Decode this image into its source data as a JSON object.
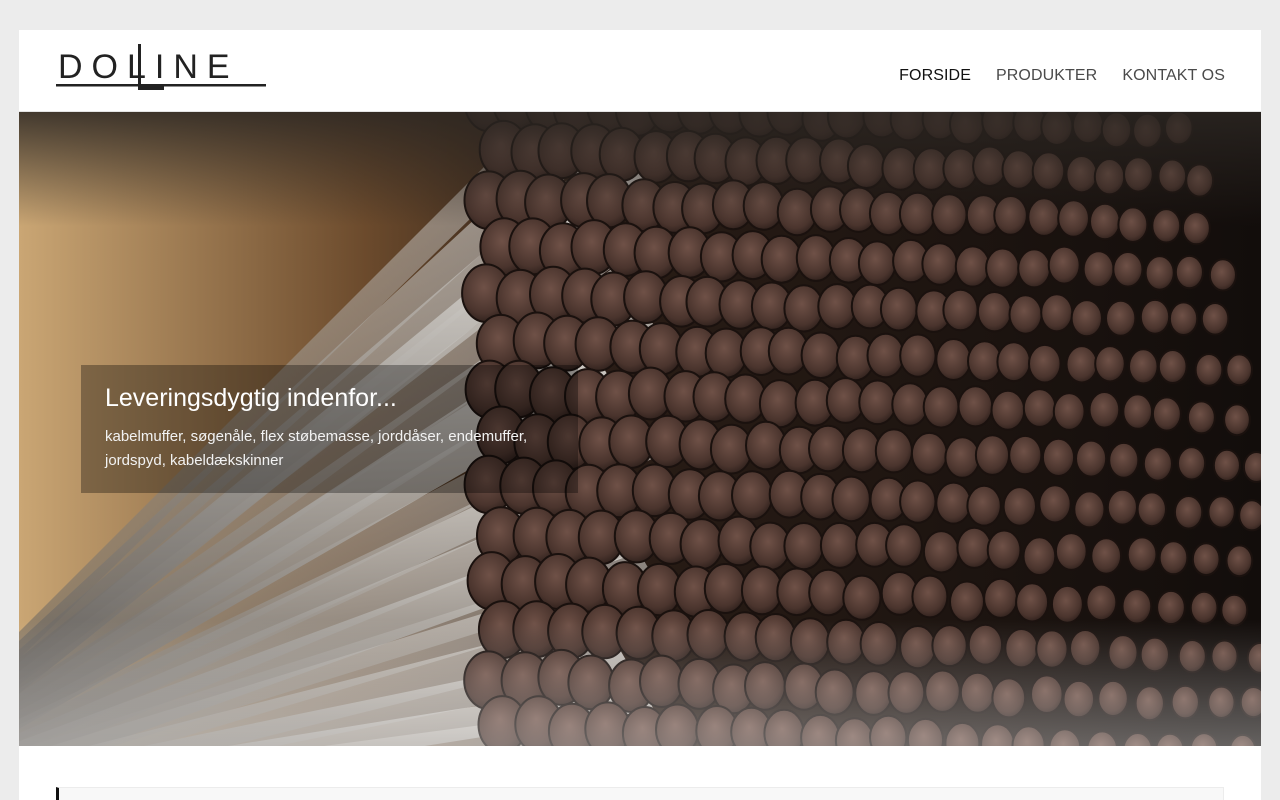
{
  "brand": {
    "name": "DOLINE"
  },
  "nav": {
    "items": [
      {
        "label": "FORSIDE",
        "active": true
      },
      {
        "label": "PRODUKTER",
        "active": false
      },
      {
        "label": "KONTAKT OS",
        "active": false
      }
    ]
  },
  "hero": {
    "title": "Leveringsdygtig indenfor...",
    "text": "kabelmuffer, søgenåle, flex støbemasse, jorddåser, endemuffer, jordspyd, kabeldækskinner"
  },
  "colors": {
    "nav_active": "#111111",
    "nav": "#4a4a4a",
    "page_bg": "#ececec",
    "accent_bar": "#111111"
  }
}
